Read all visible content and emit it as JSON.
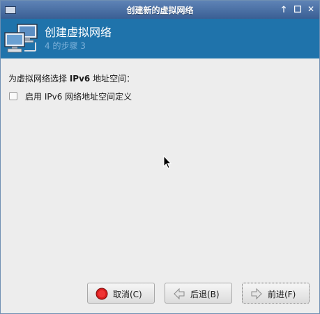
{
  "window": {
    "title": "创建新的虚拟网络",
    "controls": [
      "up-arrow-icon",
      "maximize-icon",
      "close-icon"
    ]
  },
  "header": {
    "title": "创建虚拟网络",
    "step": "4 的步骤 3"
  },
  "main": {
    "prompt_prefix": "为虚拟网络选择 ",
    "prompt_bold": "IPv6",
    "prompt_suffix": " 地址空间：",
    "checkbox_label": "启用 IPv6 网络地址空间定义",
    "checkbox_checked": false
  },
  "buttons": {
    "cancel": "取消(C)",
    "back": "后退(B)",
    "forward": "前进(F)"
  },
  "colors": {
    "titlebar": "#4a6fa5",
    "header_bg": "#1f73ab",
    "cancel_icon": "#d81e1e"
  }
}
